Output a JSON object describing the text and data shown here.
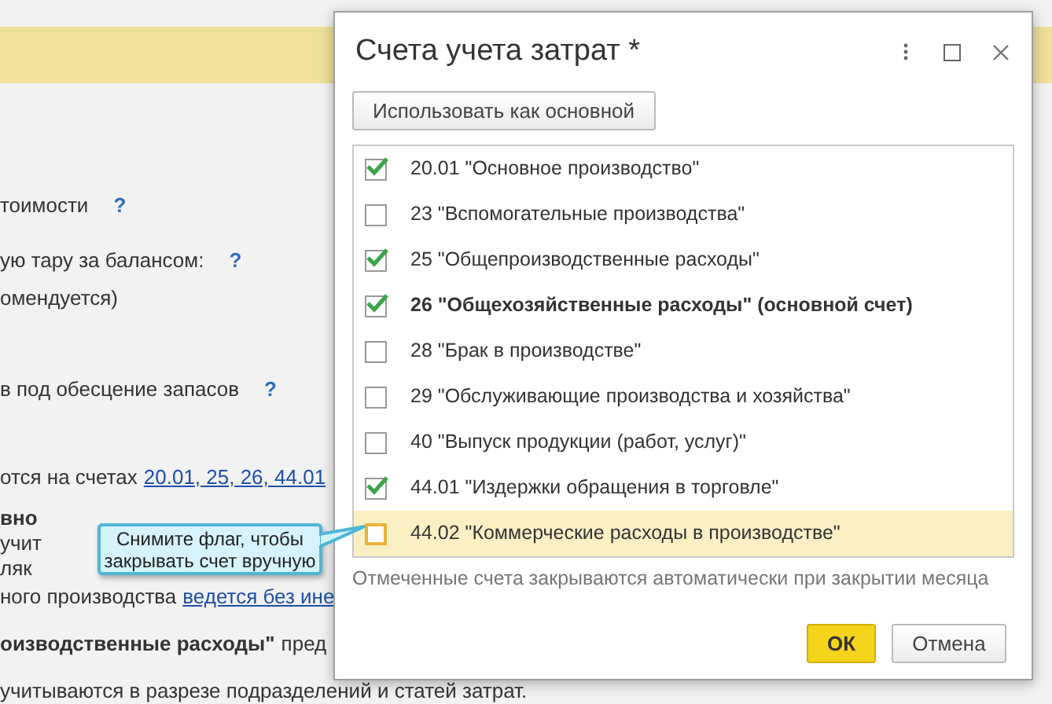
{
  "background": {
    "lines": [
      {
        "parts": [
          {
            "kind": "plain",
            "text": "тоимости"
          }
        ],
        "help": "?"
      },
      {
        "parts": [
          {
            "kind": "plain",
            "text": "ую тару за балансом:"
          }
        ],
        "help": "?"
      },
      {
        "parts": [
          {
            "kind": "plain",
            "text": "омендуется)"
          }
        ]
      },
      {
        "parts": [
          {
            "kind": "plain",
            "text": "в под обесцение запасов"
          }
        ],
        "help": "?"
      },
      {
        "parts": [
          {
            "kind": "plain",
            "text": "отся на счетах"
          },
          {
            "kind": "link",
            "text": "20.01, 25, 26, 44.01"
          }
        ]
      },
      {
        "parts": [
          {
            "kind": "bold",
            "text": "вно"
          }
        ]
      },
      {
        "parts": [
          {
            "kind": "plain",
            "text": "учит"
          }
        ]
      },
      {
        "parts": [
          {
            "kind": "plain",
            "text": "ляк"
          }
        ]
      },
      {
        "parts": [
          {
            "kind": "plain",
            "text": "ного производства"
          },
          {
            "kind": "link",
            "text": "ведется без ине"
          }
        ]
      },
      {
        "parts": [
          {
            "kind": "bold",
            "text": "оизводственные расходы\""
          },
          {
            "kind": "plain",
            "text": "пред"
          }
        ]
      },
      {
        "parts": [
          {
            "kind": "plain",
            "text": "учитываются в разрезе подразделений и статей затрат."
          }
        ]
      }
    ]
  },
  "dialog": {
    "title": "Счета учета затрат *",
    "main_button": "Использовать как основной",
    "accounts": [
      {
        "label": "20.01 \"Основное производство\"",
        "checked": true,
        "main": false,
        "selected": false
      },
      {
        "label": "23 \"Вспомогательные производства\"",
        "checked": false,
        "main": false,
        "selected": false
      },
      {
        "label": "25 \"Общепроизводственные расходы\"",
        "checked": true,
        "main": false,
        "selected": false
      },
      {
        "label": "26 \"Общехозяйственные расходы\" (основной счет)",
        "checked": true,
        "main": true,
        "selected": false
      },
      {
        "label": "28 \"Брак в производстве\"",
        "checked": false,
        "main": false,
        "selected": false
      },
      {
        "label": "29 \"Обслуживающие производства и хозяйства\"",
        "checked": false,
        "main": false,
        "selected": false
      },
      {
        "label": "40 \"Выпуск продукции (работ, услуг)\"",
        "checked": false,
        "main": false,
        "selected": false
      },
      {
        "label": "44.01 \"Издержки обращения в торговле\"",
        "checked": true,
        "main": false,
        "selected": false
      },
      {
        "label": "44.02 \"Коммерческие расходы в производстве\"",
        "checked": false,
        "main": false,
        "selected": true
      }
    ],
    "note": "Отмеченные счета закрываются автоматически при закрытии месяца",
    "ok": "ОК",
    "cancel": "Отмена"
  },
  "tooltip": {
    "text": "Снимите флаг, чтобы закрывать счет вручную"
  }
}
